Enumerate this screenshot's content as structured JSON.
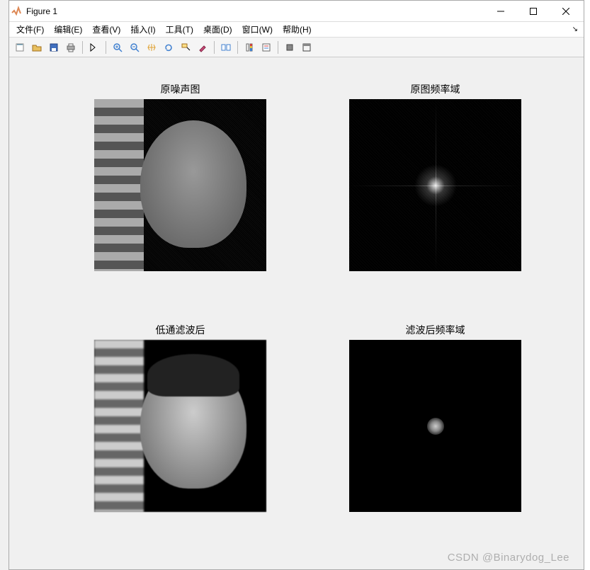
{
  "window": {
    "title": "Figure 1"
  },
  "menu": {
    "file": "文件(F)",
    "edit": "编辑(E)",
    "view": "查看(V)",
    "insert": "插入(I)",
    "tools": "工具(T)",
    "desktop": "桌面(D)",
    "window": "窗口(W)",
    "help": "帮助(H)"
  },
  "subplots": {
    "s1": "原噪声图",
    "s2": "原图频率域",
    "s3": "低通滤波后",
    "s4": "滤波后频率域"
  },
  "watermark": "CSDN @Binarydog_Lee"
}
